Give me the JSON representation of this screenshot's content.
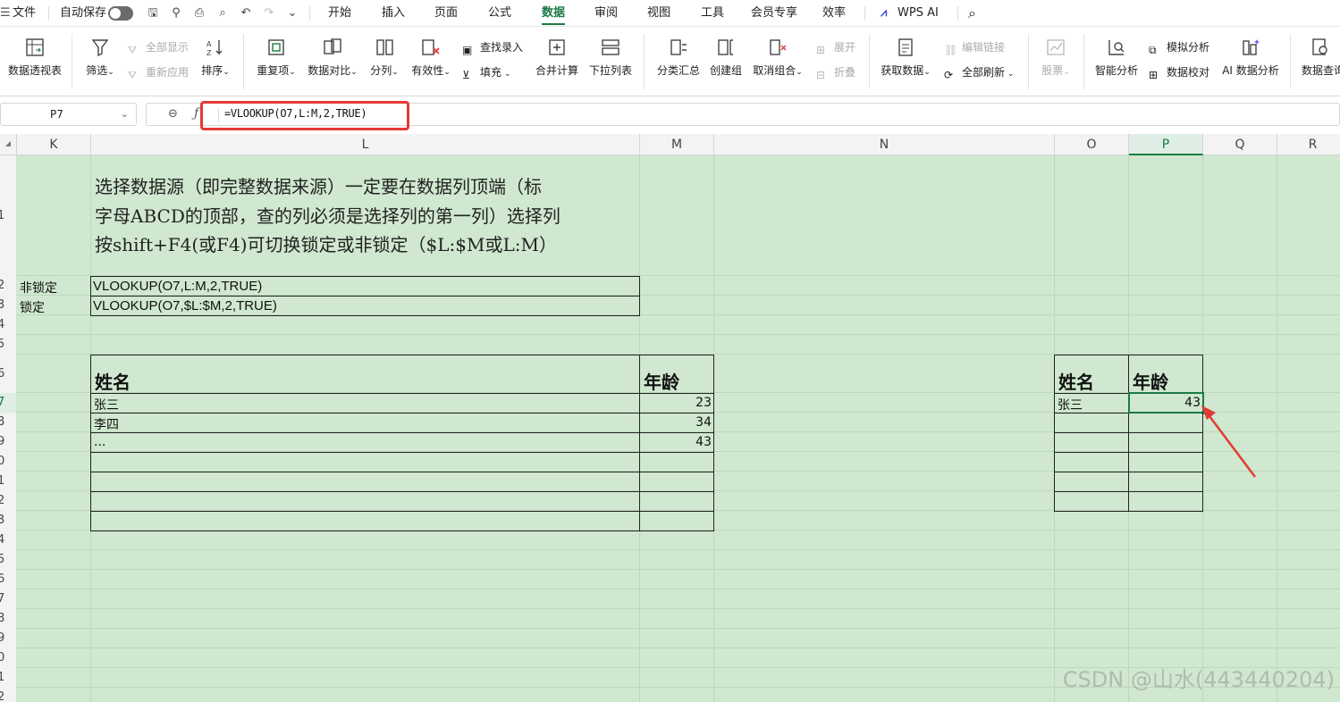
{
  "menubar": {
    "file": "文件",
    "autosave": "自动保存",
    "tabs": [
      "开始",
      "插入",
      "页面",
      "公式",
      "数据",
      "审阅",
      "视图",
      "工具",
      "会员专享",
      "效率"
    ],
    "active_tab": "数据",
    "wps_ai": "WPS AI"
  },
  "ribbon": {
    "pivot": "数据透视表",
    "filter": "筛选",
    "show_all": "全部显示",
    "reapply": "重新应用",
    "sort": "排序",
    "duplicates": "重复项",
    "compare": "数据对比",
    "split": "分列",
    "validity": "有效性",
    "lookup_entry": "查找录入",
    "fill": "填充",
    "consolidate": "合并计算",
    "dropdown": "下拉列表",
    "subtotal": "分类汇总",
    "group": "创建组",
    "ungroup": "取消组合",
    "expand": "展开",
    "collapse": "折叠",
    "get_data": "获取数据",
    "edit_links": "编辑链接",
    "refresh_all": "全部刷新",
    "stocks": "股票",
    "smart_analysis": "智能分析",
    "simulate": "模拟分析",
    "validate": "数据校对",
    "ai_analysis": "AI 数据分析",
    "data_query": "数据查询"
  },
  "formula_bar": {
    "name_box": "P7",
    "fx": "fx",
    "formula": "=VLOOKUP(O7,L:M,2,TRUE)"
  },
  "columns": [
    "K",
    "L",
    "M",
    "N",
    "O",
    "P",
    "Q",
    "R"
  ],
  "selected_column": "P",
  "row_numbers": [
    "1",
    "2",
    "3",
    "4",
    "5",
    "6",
    "7",
    "8",
    "9",
    "0",
    "1",
    "2",
    "3",
    "4",
    "5",
    "6",
    "7",
    "8",
    "9",
    "0",
    "1",
    "2"
  ],
  "note_lines": [
    "选择数据源（即完整数据来源）一定要在数据列顶端（标",
    "字母ABCD的顶部，查的列必须是选择列的第一列）选择列",
    "按shift+F4(或F4)可切换锁定或非锁定（$L:$M或L:M）"
  ],
  "formula_table": [
    {
      "label": "非锁定",
      "formula": "VLOOKUP(O7,L:M,2,TRUE)"
    },
    {
      "label": "锁定",
      "formula": "VLOOKUP(O7,$L:$M,2,TRUE)"
    }
  ],
  "source_table": {
    "headers": [
      "姓名",
      "年龄"
    ],
    "rows": [
      {
        "name": "张三",
        "age": "23"
      },
      {
        "name": "李四",
        "age": "34"
      },
      {
        "name": "...",
        "age": "43"
      }
    ]
  },
  "lookup_table": {
    "headers": [
      "姓名",
      "年龄"
    ],
    "name": "张三",
    "result": "43"
  },
  "watermark": "CSDN @山水(443440204)",
  "colors": {
    "accent": "#1a7a43",
    "grid_bg": "#cfe8cf",
    "highlight": "#e53935"
  }
}
